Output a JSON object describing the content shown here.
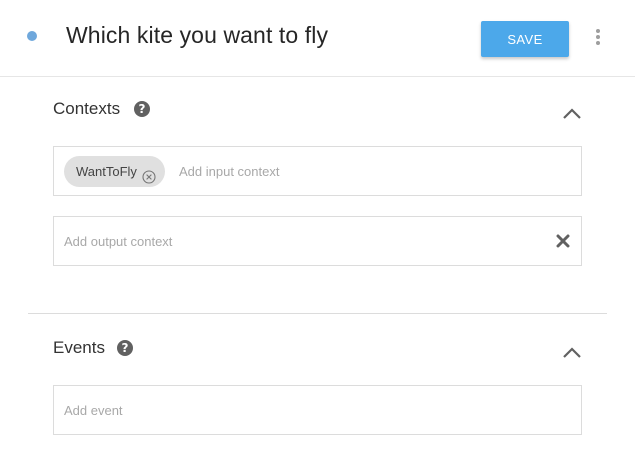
{
  "header": {
    "title": "Which kite you want to fly",
    "save_label": "SAVE",
    "status_color": "#6fa8dc",
    "more_icon": "more-vert-icon"
  },
  "contexts": {
    "title": "Contexts",
    "help_icon": "?",
    "input_chips": [
      {
        "label": "WantToFly"
      }
    ],
    "input_placeholder": "Add input context",
    "output_placeholder": "Add output context"
  },
  "events": {
    "title": "Events",
    "help_icon": "?",
    "input_placeholder": "Add event"
  },
  "colors": {
    "accent": "#4ca8ea",
    "chip_bg": "#e0e0e0"
  }
}
